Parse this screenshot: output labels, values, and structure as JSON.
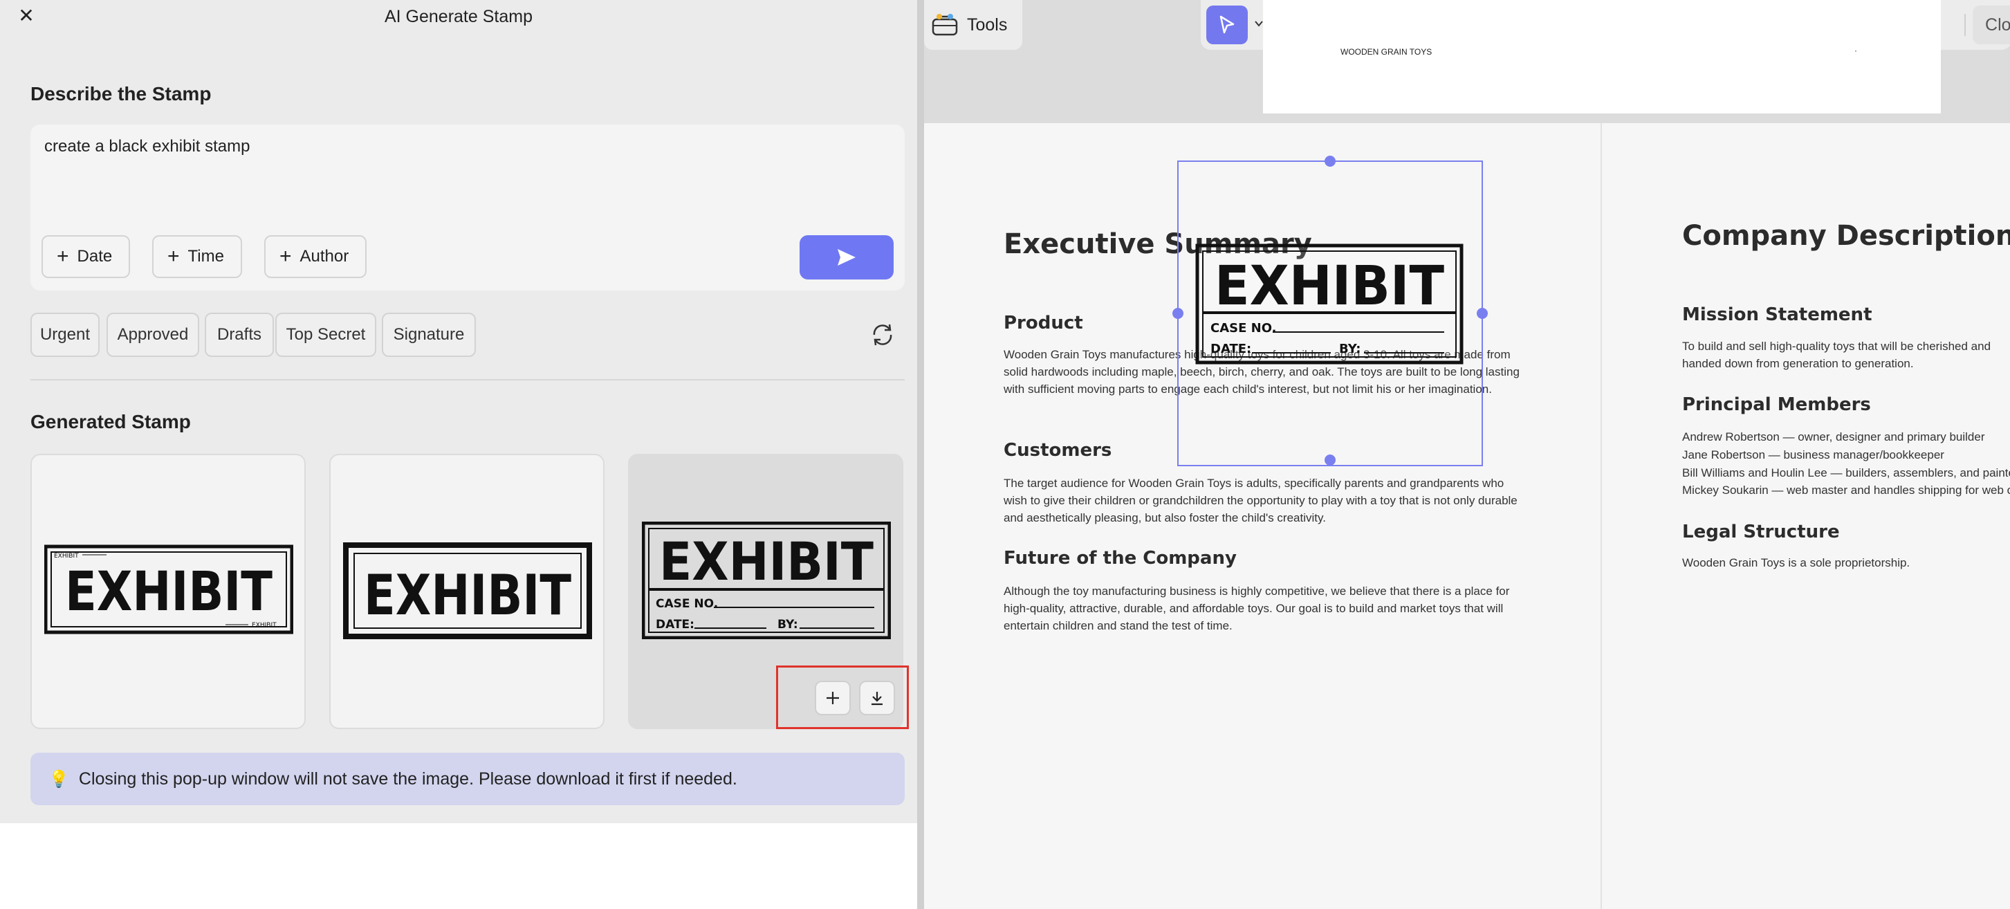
{
  "panel": {
    "title": "AI Generate Stamp",
    "close_icon": "close-icon",
    "describe_title": "Describe the Stamp",
    "prompt_value": "create a black exhibit stamp",
    "chips": [
      {
        "label": "Date"
      },
      {
        "label": "Time"
      },
      {
        "label": "Author"
      }
    ],
    "send_icon": "send-icon",
    "tags": [
      "Urgent",
      "Approved",
      "Drafts",
      "Top Secret",
      "Signature"
    ],
    "refresh_icon": "refresh-icon",
    "generated_title": "Generated Stamp",
    "stamps": [
      {
        "main": "EXHIBIT",
        "small_top": "EXHIBIT",
        "small_bottom": "EXHIBIT"
      },
      {
        "main": "EXHIBIT"
      },
      {
        "main": "EXHIBIT",
        "case_label": "CASE NO.",
        "date_label": "DATE:",
        "by_label": "BY:"
      }
    ],
    "notice_text": "Closing this pop-up window will not save the image. Please download it first if needed.",
    "notice_icon": "lightbulb-icon"
  },
  "viewer": {
    "tools_label": "Tools",
    "close_label": "Close",
    "toolbar_icons": [
      "select-cursor-icon",
      "text-callout-icon",
      "text-icon",
      "comment-icon",
      "highlighter-icon",
      "shape-icon",
      "measure-icon",
      "attachment-icon",
      "sticker-icon",
      "stamp-icon",
      "signature-icon"
    ],
    "top_page_label": "WOODEN GRAIN TOYS",
    "placed_stamp": {
      "main": "EXHIBIT",
      "case_label": "CASE NO.",
      "date_label": "DATE:",
      "by_label": "BY:"
    }
  },
  "document": {
    "exec_title": "Executive Summary",
    "product_heading": "Product",
    "product_text": "Wooden Grain Toys manufactures high-quality toys for children aged 3-10. All toys are made from solid hardwoods including maple, beech, birch, cherry, and oak. The toys are built to be long lasting with sufficient moving parts to engage each child's interest, but not limit his or her imagination.",
    "customers_heading": "Customers",
    "customers_text": "The target audience for Wooden Grain Toys is adults, specifically parents and grandparents who wish to give their children or grandchildren the opportunity to play with a toy that is not only durable and aesthetically pleasing, but also foster the child's creativity.",
    "future_heading": "Future of the Company",
    "future_text": "Although the toy manufacturing business is highly competitive, we believe that there is a place for high-quality, attractive, durable, and affordable toys. Our goal is to build and market toys that will entertain children and stand the test of time.",
    "company_title": "Company Description",
    "mission_heading": "Mission Statement",
    "mission_text": "To build and sell high-quality toys that will be cherished and handed down from generation to generation.",
    "principal_heading": "Principal Members",
    "principal_lines": [
      "Andrew Robertson — owner, designer and primary builder",
      "Jane Robertson — business manager/bookkeeper",
      "Bill Williams and Houlin Lee — builders, assemblers, and painters",
      "Mickey Soukarin — web master and handles shipping for web orders"
    ],
    "legal_heading": "Legal Structure",
    "legal_text": "Wooden Grain Toys is a sole proprietorship."
  }
}
